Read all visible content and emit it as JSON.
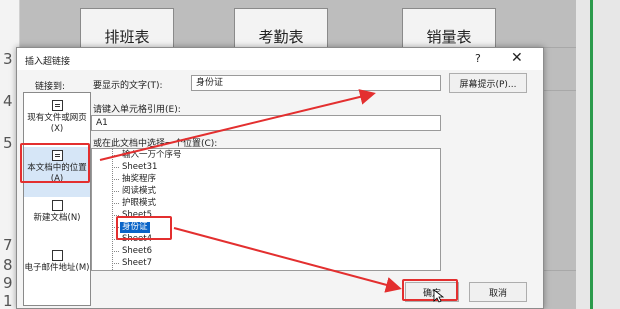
{
  "spreadsheet": {
    "row_numbers": [
      "3",
      "4",
      "5",
      "7",
      "8",
      "9",
      "1"
    ],
    "buttons": [
      "排班表",
      "考勤表",
      "销量表"
    ]
  },
  "dialog": {
    "title": "插入超链接",
    "help_label": "?",
    "close_label": "✕",
    "link_to_label": "链接到:",
    "nav_items": [
      {
        "label": "现有文件或网页(X)",
        "icon": "document-icon"
      },
      {
        "label": "本文档中的位置(A)",
        "icon": "place-in-document-icon"
      },
      {
        "label": "新建文档(N)",
        "icon": "new-document-icon"
      },
      {
        "label": "电子邮件地址(M)",
        "icon": "email-icon"
      }
    ],
    "display_text_label": "要显示的文字(T):",
    "display_text_value": "身份证",
    "screentip_label": "屏幕提示(P)...",
    "cell_ref_label": "请键入单元格引用(E):",
    "cell_ref_value": "A1",
    "place_label": "或在此文档中选择一个位置(C):",
    "tree_items": [
      "输入一万个序号",
      "Sheet31",
      "抽奖程序",
      "阅读模式",
      "护眼模式",
      "Sheet5",
      "身份证",
      "Sheet4",
      "Sheet6",
      "Sheet7"
    ],
    "selected_item": "身份证",
    "ok_label": "确定",
    "cancel_label": "取消"
  },
  "colors": {
    "annotation": "#e32f2f",
    "selection": "#0a64c8",
    "excel_green": "#2a9a4b"
  }
}
